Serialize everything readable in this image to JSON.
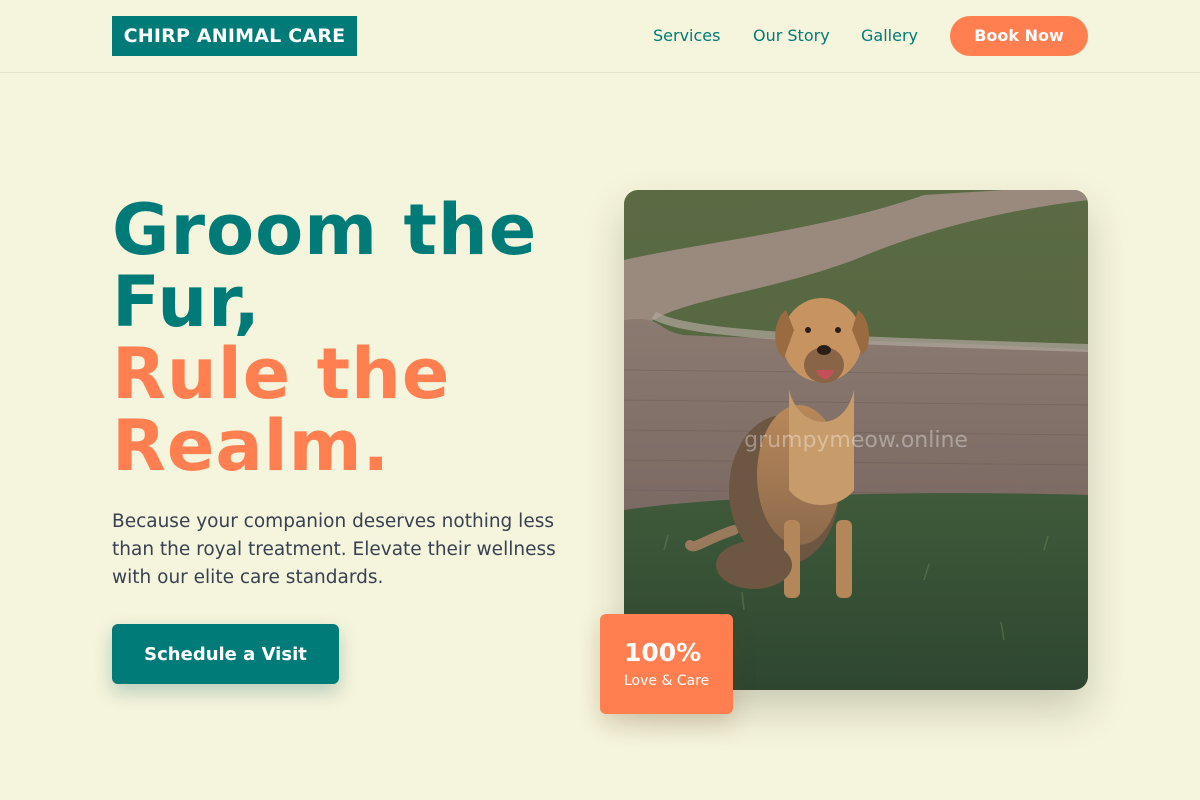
{
  "brand": {
    "logo_text": "CHIRP ANIMAL CARE"
  },
  "nav": {
    "items": [
      {
        "label": "Services"
      },
      {
        "label": "Our Story"
      },
      {
        "label": "Gallery"
      }
    ],
    "cta_label": "Book Now"
  },
  "hero": {
    "headline_line1": "Groom the",
    "headline_line2": "Fur,",
    "headline_line3": "Rule the",
    "headline_line4": "Realm.",
    "subtext": "Because your companion deserves nothing less than the royal treatment. Elevate their wellness with our elite care standards.",
    "cta_label": "Schedule a Visit"
  },
  "photo": {
    "subject": "dog sitting on grass near a brick path",
    "watermark": "grumpymeow.online"
  },
  "stat": {
    "value": "100%",
    "label": "Love & Care"
  },
  "colors": {
    "primary": "#007b78",
    "accent": "#ff7f50",
    "background": "#f5f4dc",
    "text": "#374151"
  }
}
